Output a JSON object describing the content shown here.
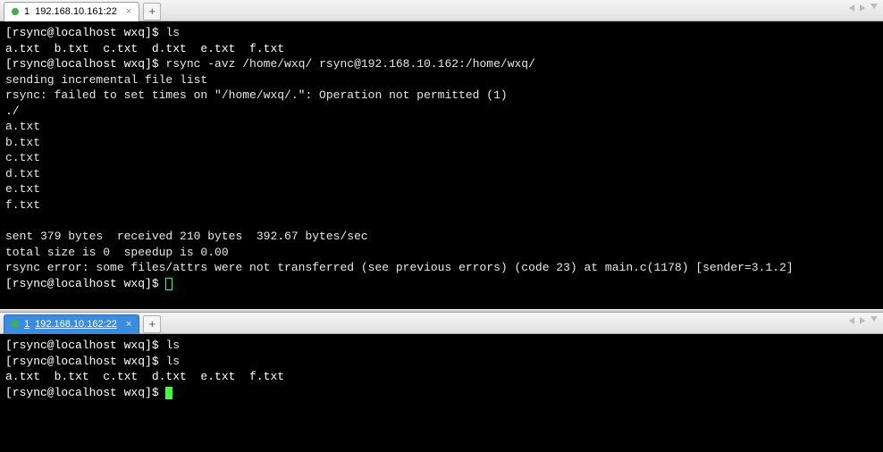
{
  "pane1": {
    "tab": {
      "index": "1",
      "label": "192.168.10.161:22"
    },
    "lines": {
      "l1_prompt": "[rsync@localhost wxq]$ ",
      "l1_cmd": "ls",
      "l2_files": "a.txt  b.txt  c.txt  d.txt  e.txt  f.txt",
      "l3_prompt": "[rsync@localhost wxq]$ ",
      "l3_cmd": "rsync -avz /home/wxq/ rsync@192.168.10.162:/home/wxq/",
      "l4": "sending incremental file list",
      "l5": "rsync: failed to set times on \"/home/wxq/.\": Operation not permitted (1)",
      "l6": "./",
      "l7": "a.txt",
      "l8": "b.txt",
      "l9": "c.txt",
      "l10": "d.txt",
      "l11": "e.txt",
      "l12": "f.txt",
      "l13": "",
      "l14": "sent 379 bytes  received 210 bytes  392.67 bytes/sec",
      "l15": "total size is 0  speedup is 0.00",
      "l16": "rsync error: some files/attrs were not transferred (see previous errors) (code 23) at main.c(1178) [sender=3.1.2]",
      "l17_prompt": "[rsync@localhost wxq]$ "
    }
  },
  "pane2": {
    "tab": {
      "index": "1",
      "label": "192.168.10.162:22"
    },
    "lines": {
      "l1_prompt": "[rsync@localhost wxq]$ ",
      "l1_cmd": "ls",
      "l2_prompt": "[rsync@localhost wxq]$ ",
      "l2_cmd": "ls",
      "l3_files": "a.txt  b.txt  c.txt  d.txt  e.txt  f.txt",
      "l4_prompt": "[rsync@localhost wxq]$ "
    }
  }
}
